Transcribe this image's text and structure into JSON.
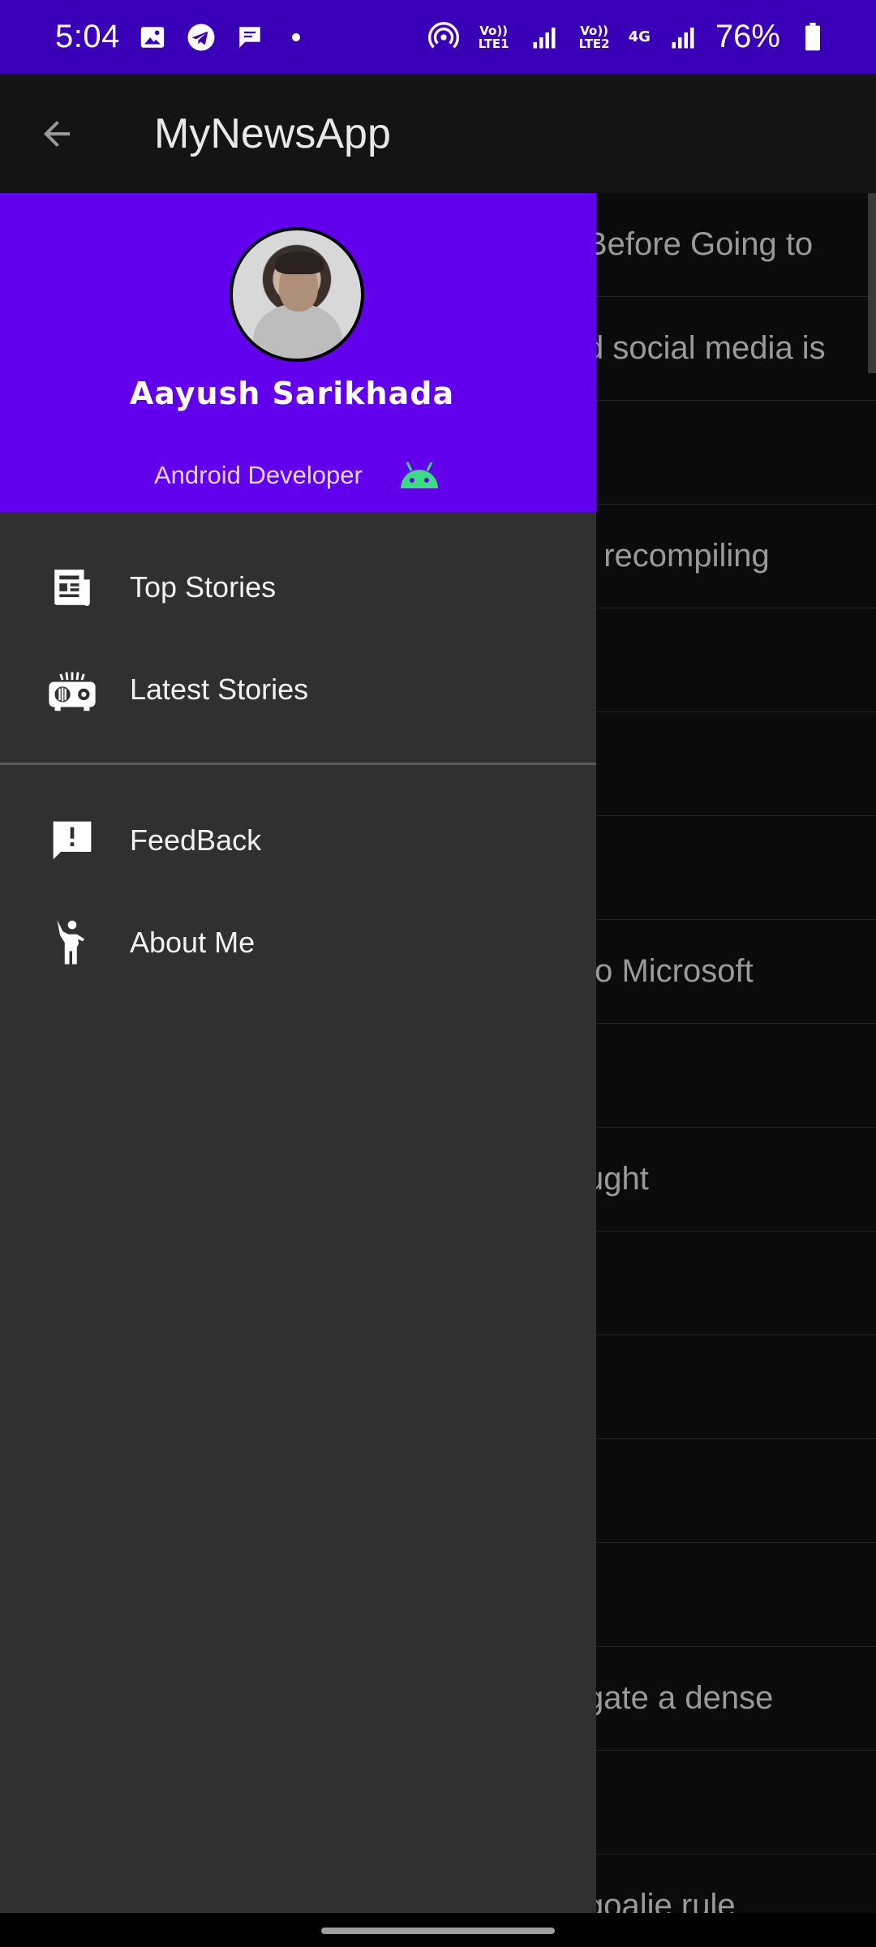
{
  "status_bar": {
    "time": "5:04",
    "sim1": "Vo)) LTE1",
    "sim2": "Vo)) LTE2",
    "network": "4G",
    "battery": "76%",
    "icons": [
      "gallery-icon",
      "telegram-icon",
      "message-icon",
      "hotspot-icon",
      "signal-icon",
      "battery-icon"
    ],
    "background_color": "#3a00b8"
  },
  "app_bar": {
    "title": "MyNewsApp",
    "back_icon": "arrow-left-icon"
  },
  "drawer": {
    "header": {
      "name": "Aayush Sarikhada",
      "subtitle": "Android Developer",
      "background_color": "#6200ee",
      "badge_icon": "android-icon",
      "badge_color": "#3ddc84"
    },
    "primary_items": [
      {
        "label": "Top Stories",
        "icon": "newspaper-icon"
      },
      {
        "label": "Latest Stories",
        "icon": "radio-icon"
      }
    ],
    "secondary_items": [
      {
        "label": "FeedBack",
        "icon": "feedback-icon"
      },
      {
        "label": "About Me",
        "icon": "person-waving-icon"
      }
    ]
  },
  "background_list": [
    "Before Going to",
    "d social media is",
    "",
    ", recompiling",
    "",
    "",
    "",
    "to Microsoft",
    "",
    "ught",
    "",
    "",
    "",
    "",
    "gate a dense",
    "",
    "goalie rule"
  ]
}
